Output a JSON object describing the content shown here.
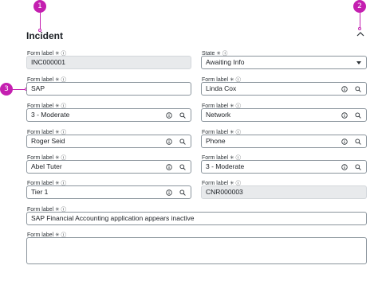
{
  "callouts": [
    "1",
    "2",
    "3"
  ],
  "section": {
    "title": "Incident"
  },
  "fields": {
    "number": {
      "label": "Form label",
      "value": "INC000001"
    },
    "state": {
      "label": "State",
      "value": "Awaiting Info"
    },
    "company": {
      "label": "Form label",
      "value": "SAP"
    },
    "caller": {
      "label": "Form label",
      "value": "Linda Cox"
    },
    "impact": {
      "label": "Form label",
      "value": "3 - Moderate"
    },
    "category": {
      "label": "Form label",
      "value": "Network"
    },
    "assigned": {
      "label": "Form label",
      "value": "Roger Seid"
    },
    "channel": {
      "label": "Form label",
      "value": "Phone"
    },
    "opened_by": {
      "label": "Form label",
      "value": "Abel Tuter"
    },
    "urgency": {
      "label": "Form label",
      "value": "3 - Moderate"
    },
    "tier": {
      "label": "Form label",
      "value": "Tier 1"
    },
    "cnr": {
      "label": "Form label",
      "value": "CNR000003"
    },
    "short_desc": {
      "label": "Form label",
      "value": "SAP Financial Accounting application appears inactive"
    },
    "description": {
      "label": "Form label",
      "value": ""
    }
  },
  "glyphs": {
    "required": "✳",
    "info": "ⓘ"
  },
  "colors": {
    "callout": "#c41fb0",
    "readonly_bg": "#e8eaec",
    "border": "#8a949c"
  }
}
